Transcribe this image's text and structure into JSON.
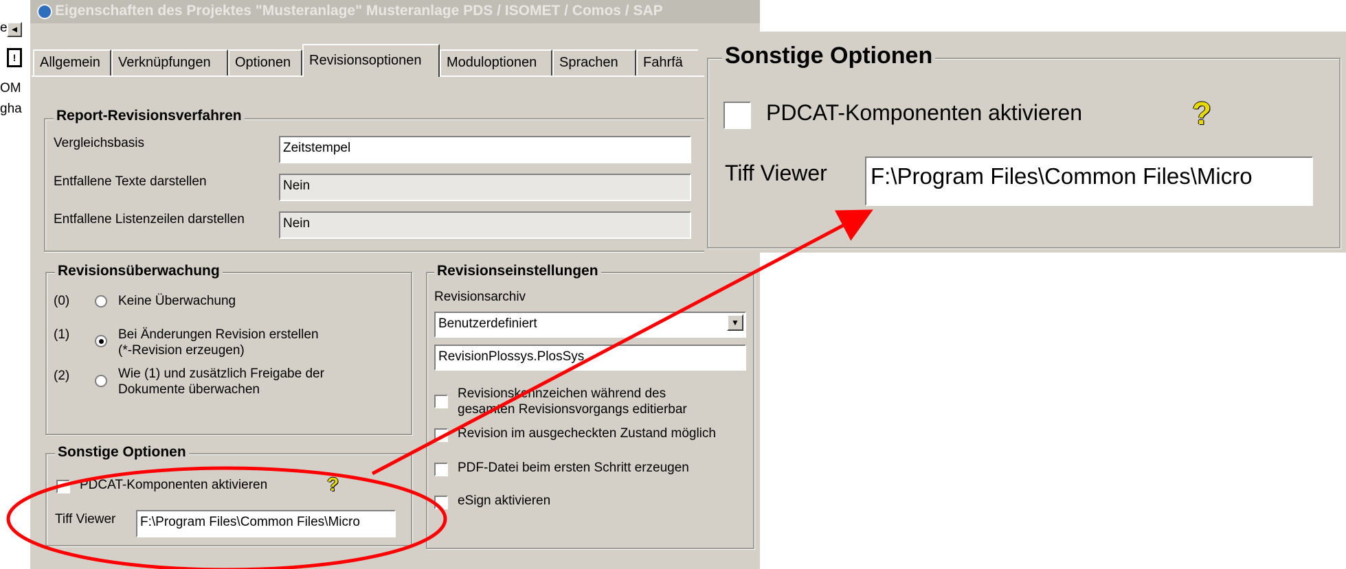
{
  "window": {
    "title": "Eigenschaften des Projektes \"Musteranlage\" Musteranlage PDS / ISOMET / Comos / SAP"
  },
  "left_strip": {
    "scroll_glyph": "◄",
    "tool_glyph": "!",
    "fragments": [
      "OM",
      "gha",
      "e"
    ]
  },
  "tabs": [
    "Allgemein",
    "Verknüpfungen",
    "Optionen",
    "Revisionsoptionen",
    "Moduloptionen",
    "Sprachen",
    "Fahrfä"
  ],
  "report_revision": {
    "title": "Report-Revisionsverfahren",
    "rows": [
      {
        "label": "Vergleichsbasis",
        "value": "Zeitstempel"
      },
      {
        "label": "Entfallene Texte darstellen",
        "value": "Nein"
      },
      {
        "label": "Entfallene Listenzeilen darstellen",
        "value": "Nein"
      }
    ]
  },
  "revision_monitoring": {
    "title": "Revisionsüberwachung",
    "options": [
      {
        "code": "(0)",
        "line1": "Keine Überwachung",
        "line2": "",
        "selected": false
      },
      {
        "code": "(1)",
        "line1": "Bei Änderungen Revision erstellen",
        "line2": "(*-Revision erzeugen)",
        "selected": true
      },
      {
        "code": "(2)",
        "line1": "Wie (1) und zusätzlich Freigabe der",
        "line2": "Dokumente überwachen",
        "selected": false
      }
    ]
  },
  "revision_settings": {
    "title": "Revisionseinstellungen",
    "archive_label": "Revisionsarchiv",
    "archive_value": "Benutzerdefiniert",
    "archive_path": "RevisionPlossys.PlosSys",
    "dropdown_glyph": "▼",
    "checks": [
      {
        "line1": "Revisionskennzeichen während des",
        "line2": "gesamten Revisionsvorgangs editierbar",
        "checked": false
      },
      {
        "line1": "Revision im ausgecheckten Zustand möglich",
        "line2": "",
        "checked": false
      },
      {
        "line1": "PDF-Datei beim ersten Schritt erzeugen",
        "line2": "",
        "checked": false
      },
      {
        "line1": "eSign aktivieren",
        "line2": "",
        "checked": false
      }
    ]
  },
  "other_options": {
    "title": "Sonstige Optionen",
    "pdcat_label": "PDCAT-Komponenten aktivieren",
    "pdcat_checked": false,
    "help_glyph": "?",
    "tiff_label": "Tiff Viewer",
    "tiff_value": "F:\\Program Files\\Common Files\\Micro"
  },
  "annotation": {
    "color": "#ff0000"
  }
}
